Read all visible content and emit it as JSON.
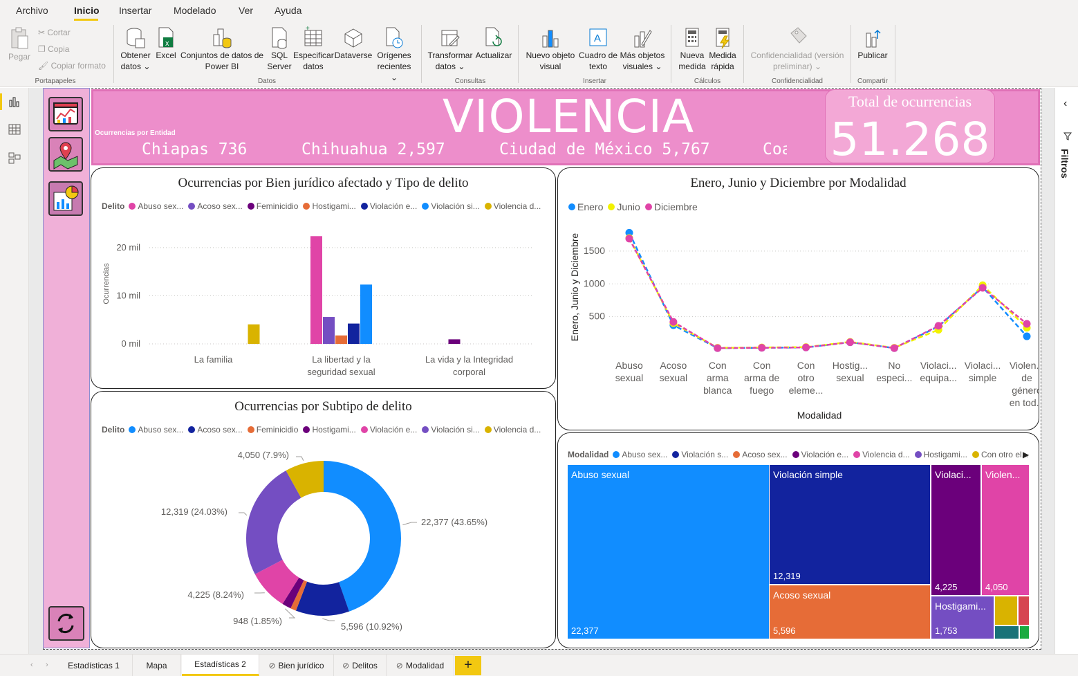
{
  "menu": {
    "items": [
      "Archivo",
      "Inicio",
      "Insertar",
      "Modelado",
      "Ver",
      "Ayuda"
    ],
    "active": "Inicio"
  },
  "ribbon": {
    "clipboard": {
      "paste": "Pegar",
      "cut": "Cortar",
      "copy": "Copia",
      "format": "Copiar formato",
      "group": "Portapapeles"
    },
    "data": {
      "get_data": [
        "Obtener",
        "datos"
      ],
      "excel": "Excel",
      "datasets": [
        "Conjuntos de datos de",
        "Power BI"
      ],
      "sql": [
        "SQL",
        "Server"
      ],
      "enter": [
        "Especificar",
        "datos"
      ],
      "dataverse": "Dataverse",
      "recent": [
        "Orígenes",
        "recientes"
      ],
      "group": "Datos"
    },
    "queries": {
      "transform": [
        "Transformar",
        "datos"
      ],
      "refresh": "Actualizar",
      "group": "Consultas"
    },
    "insert": {
      "new_visual": [
        "Nuevo objeto",
        "visual"
      ],
      "textbox": [
        "Cuadro de",
        "texto"
      ],
      "more_visuals": [
        "Más objetos",
        "visuales"
      ],
      "group": "Insertar"
    },
    "calculations": {
      "new_measure": [
        "Nueva",
        "medida"
      ],
      "quick_measure": [
        "Medida",
        "rápida"
      ],
      "group": "Cálculos"
    },
    "sensitivity": {
      "label": [
        "Confidencialidad (versión",
        "preliminar)"
      ],
      "group": "Confidencialidad"
    },
    "share": {
      "publish": "Publicar",
      "group": "Compartir"
    }
  },
  "header": {
    "title": "VIOLENCIA",
    "entity_label": "Ocurrencias por Entidad",
    "ticker": [
      "Chiapas 736",
      "Chihuahua 2,597",
      "Ciudad de México 5,767",
      "Coa"
    ],
    "total_label": "Total de ocurrencias",
    "total_value": "51.268"
  },
  "filters_label": "Filtros",
  "colors": {
    "blue": "#118dff",
    "navy": "#12239e",
    "orange": "#e66c37",
    "purple": "#6b007b",
    "pink": "#e044a7",
    "violet": "#744ec2",
    "gold": "#d9b300",
    "red": "#d64550",
    "teal": "#197278",
    "green": "#1aab40",
    "yellow": "#f2f200"
  },
  "bar_chart": {
    "title": "Ocurrencias por Bien jurídico afectado y Tipo de delito",
    "legend_title": "Delito",
    "legend": [
      "Abuso sex...",
      "Acoso sex...",
      "Feminicidio",
      "Hostigami...",
      "Violación e...",
      "Violación si...",
      "Violencia d..."
    ],
    "ylabel": "Ocurrencias"
  },
  "line_chart": {
    "title": "Enero, Junio y Diciembre por Modalidad",
    "legend": [
      "Enero",
      "Junio",
      "Diciembre"
    ],
    "ylabel": "Enero, Junio y Diciembre",
    "xlabel": "Modalidad"
  },
  "donut_chart": {
    "title": "Ocurrencias por Subtipo de delito",
    "legend_title": "Delito",
    "legend": [
      "Abuso sex...",
      "Acoso sex...",
      "Feminicidio",
      "Hostigami...",
      "Violación e...",
      "Violación si...",
      "Violencia d..."
    ]
  },
  "treemap": {
    "legend_title": "Modalidad",
    "legend": [
      "Abuso sex...",
      "Violación s...",
      "Acoso sex...",
      "Violación e...",
      "Violencia d...",
      "Hostigami...",
      "Con otro el..."
    ],
    "cells": [
      {
        "label": "Abuso sexual",
        "value": "22,377"
      },
      {
        "label": "Violación simple",
        "value": "12,319"
      },
      {
        "label": "Acoso sexual",
        "value": "5,596"
      },
      {
        "label": "Violaci...",
        "value": "4,225"
      },
      {
        "label": "Violen...",
        "value": "4,050"
      },
      {
        "label": "Hostigami...",
        "value": "1,753"
      }
    ]
  },
  "tabs": [
    "Estadísticas 1",
    "Mapa",
    "Estadísticas 2",
    "Bien jurídico",
    "Delitos",
    "Modalidad"
  ],
  "active_tab": "Estadísticas 2",
  "chart_data": [
    {
      "type": "bar",
      "title": "Ocurrencias por Bien jurídico afectado y Tipo de delito",
      "ylabel": "Ocurrencias",
      "ylim": [
        0,
        24000
      ],
      "yticks": [
        "0 mil",
        "10 mil",
        "20 mil"
      ],
      "categories": [
        "La familia",
        "La libertad y la seguridad sexual",
        "La vida y la Integridad corporal"
      ],
      "category_labels": [
        [
          "La familia"
        ],
        [
          "La libertad y la",
          "seguridad sexual"
        ],
        [
          "La vida y la Integridad",
          "corporal"
        ]
      ],
      "series": [
        {
          "name": "Abuso sex...",
          "color": "#e044a7",
          "values": [
            0,
            22377,
            0
          ]
        },
        {
          "name": "Acoso sex...",
          "color": "#744ec2",
          "values": [
            0,
            5596,
            0
          ]
        },
        {
          "name": "Feminicidio",
          "color": "#6b007b",
          "values": [
            0,
            0,
            948
          ]
        },
        {
          "name": "Hostigami...",
          "color": "#e66c37",
          "values": [
            0,
            1753,
            0
          ]
        },
        {
          "name": "Violación e...",
          "color": "#12239e",
          "values": [
            0,
            4225,
            0
          ]
        },
        {
          "name": "Violación si...",
          "color": "#118dff",
          "values": [
            0,
            12319,
            0
          ]
        },
        {
          "name": "Violencia d...",
          "color": "#d9b300",
          "values": [
            4050,
            0,
            0
          ]
        }
      ],
      "grid": true,
      "legend": "top-left"
    },
    {
      "type": "line",
      "title": "Enero, Junio y Diciembre por Modalidad",
      "xlabel": "Modalidad",
      "ylabel": "Enero, Junio y Diciembre",
      "ylim": [
        0,
        1900
      ],
      "yticks": [
        500,
        1000,
        1500
      ],
      "categories": [
        "Abuso sexual",
        "Acoso sexual",
        "Con arma blanca",
        "Con arma de fuego",
        "Con otro eleme...",
        "Hostig... sexual",
        "No especi...",
        "Violaci... equipa...",
        "Violaci... simple",
        "Violen... de género en tod..."
      ],
      "category_labels": [
        [
          "Abuso",
          "sexual"
        ],
        [
          "Acoso",
          "sexual"
        ],
        [
          "Con",
          "arma",
          "blanca"
        ],
        [
          "Con",
          "arma de",
          "fuego"
        ],
        [
          "Con",
          "otro",
          "eleme..."
        ],
        [
          "Hostig...",
          "sexual"
        ],
        [
          "No",
          "especi..."
        ],
        [
          "Violaci...",
          "equipa..."
        ],
        [
          "Violaci...",
          "simple"
        ],
        [
          "Violen...",
          "de",
          "género",
          "en tod..."
        ]
      ],
      "series": [
        {
          "name": "Enero",
          "color": "#118dff",
          "values": [
            1780,
            370,
            20,
            25,
            30,
            110,
            20,
            350,
            950,
            200
          ]
        },
        {
          "name": "Junio",
          "color": "#f2f200",
          "values": [
            1700,
            400,
            25,
            30,
            35,
            115,
            25,
            300,
            980,
            330
          ]
        },
        {
          "name": "Diciembre",
          "color": "#e044a7",
          "values": [
            1690,
            420,
            20,
            25,
            30,
            110,
            20,
            360,
            940,
            390
          ]
        }
      ],
      "grid": true,
      "legend": "top-left"
    },
    {
      "type": "pie",
      "title": "Ocurrencias por Subtipo de delito",
      "donut": true,
      "slices": [
        {
          "name": "Abuso sex...",
          "value": 22377,
          "label": "22,377 (43.65%)",
          "color": "#118dff"
        },
        {
          "name": "Acoso sex...",
          "value": 5596,
          "label": "5,596 (10.92%)",
          "color": "#12239e"
        },
        {
          "name": "Feminicidio",
          "value": 600,
          "label": "",
          "color": "#e66c37"
        },
        {
          "name": "Hostigami...",
          "value": 948,
          "label": "948 (1.85%)",
          "color": "#6b007b"
        },
        {
          "name": "Violación e...",
          "value": 4225,
          "label": "4,225 (8.24%)",
          "color": "#e044a7"
        },
        {
          "name": "Violación si...",
          "value": 12319,
          "label": "12,319 (24.03%)",
          "color": "#744ec2"
        },
        {
          "name": "Violencia d...",
          "value": 4050,
          "label": "4,050 (7.9%)",
          "color": "#d9b300"
        }
      ],
      "legend": "top-left"
    }
  ]
}
